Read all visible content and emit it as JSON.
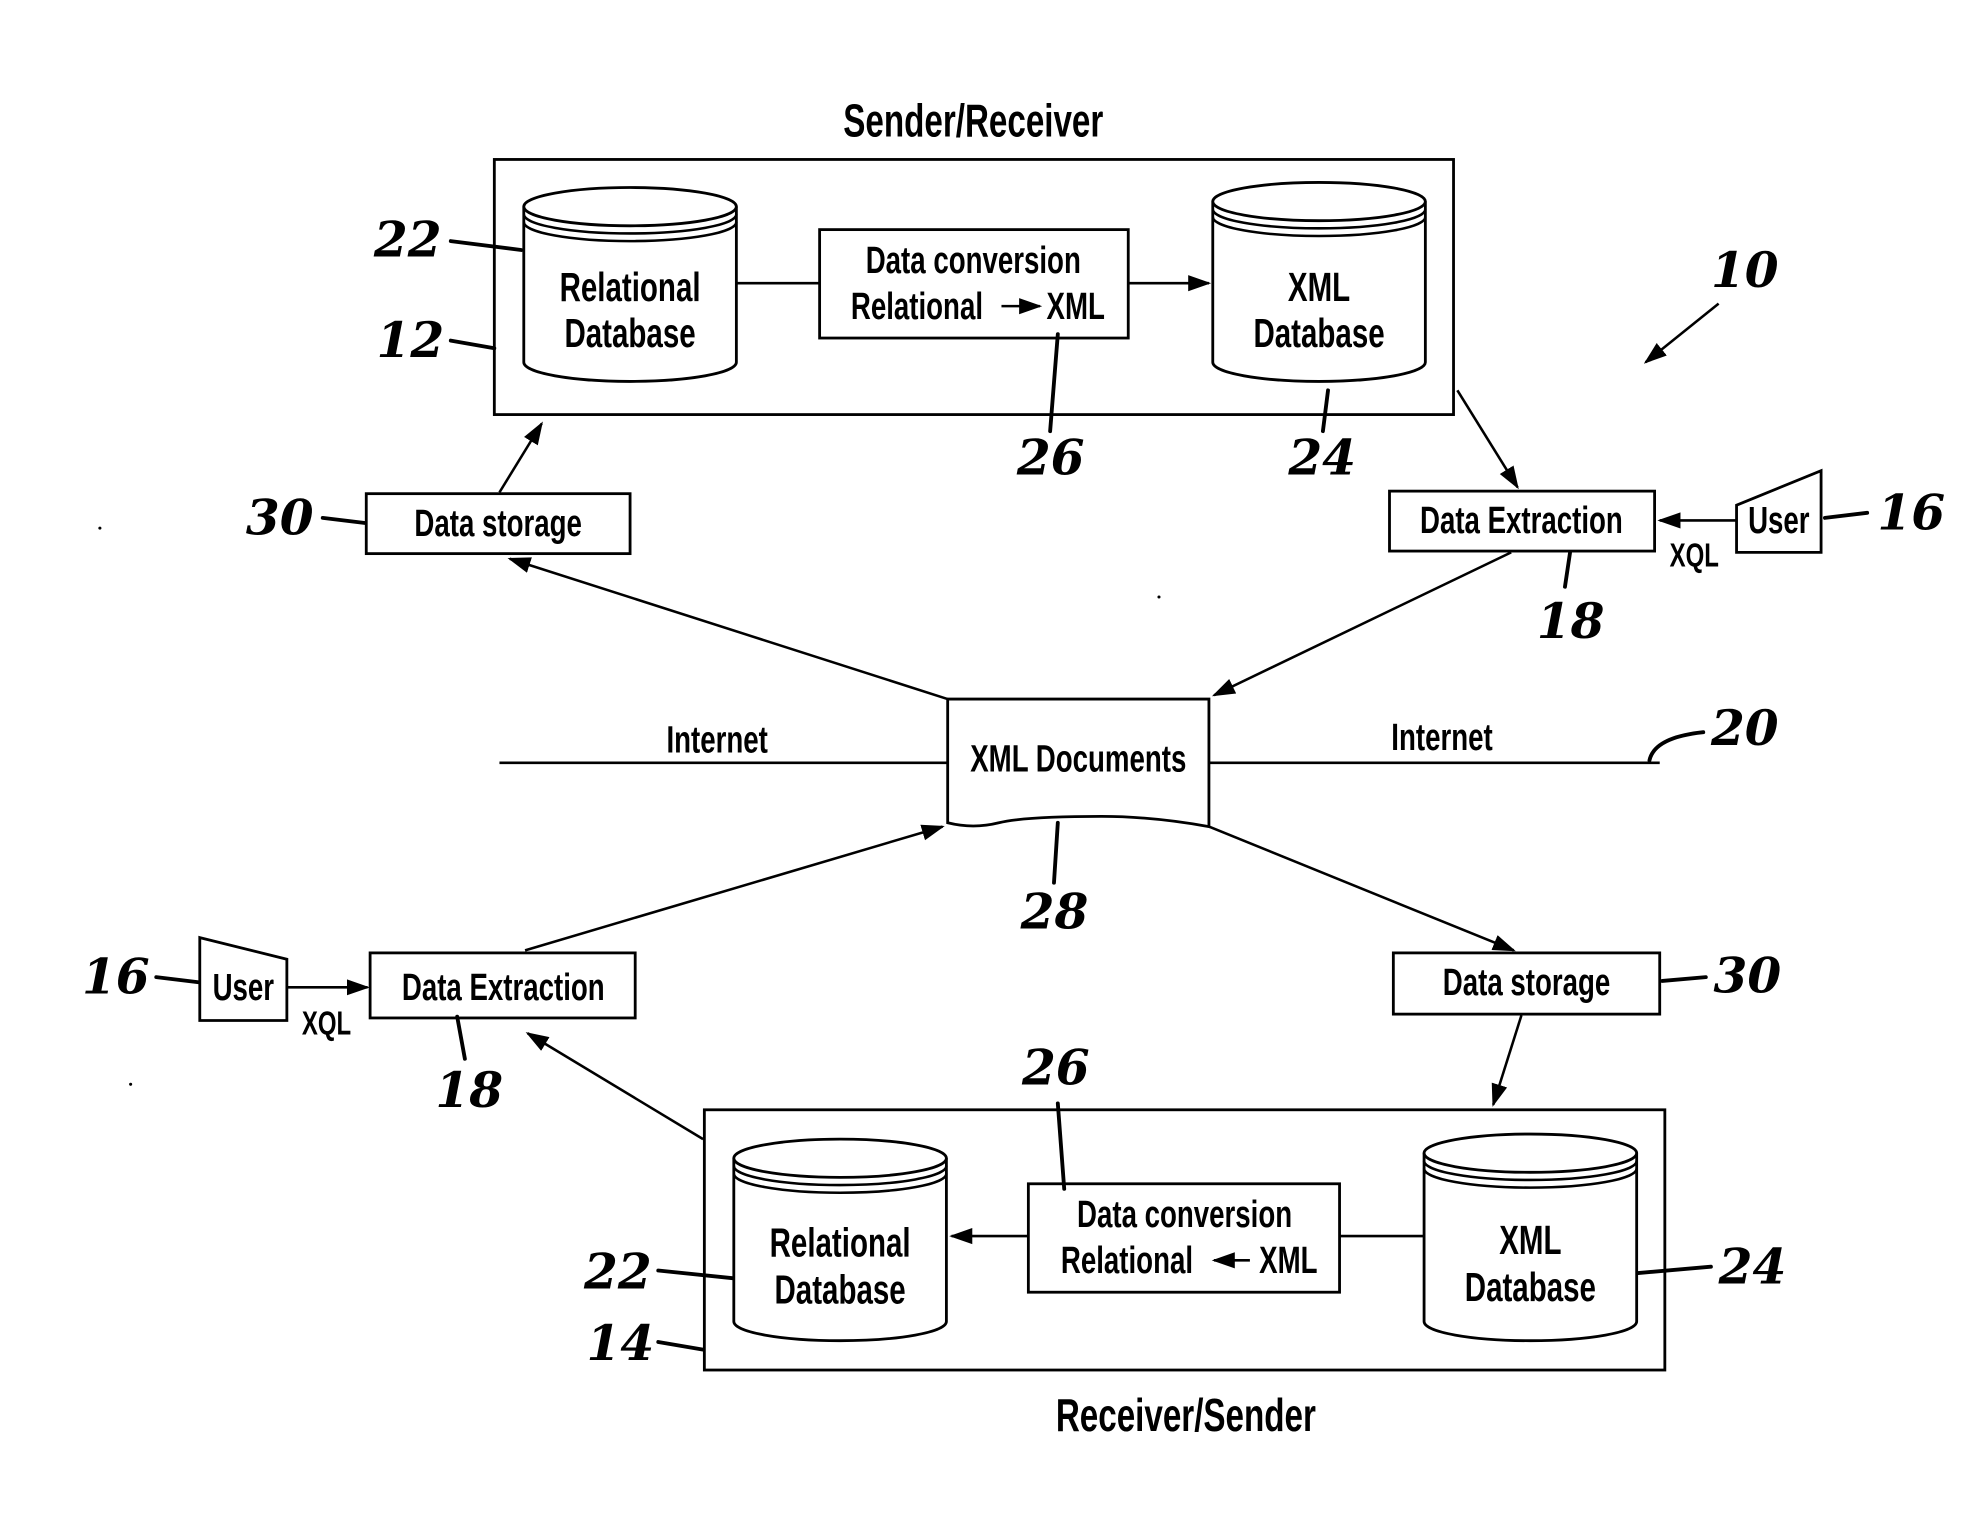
{
  "figure": {
    "system_ref": "10",
    "top_site": {
      "title": "Sender/Receiver",
      "ref": "12",
      "relational_db": {
        "line1": "Relational",
        "line2": "Database",
        "ref": "22"
      },
      "converter": {
        "line1": "Data conversion",
        "line2_left": "Relational",
        "line2_right": "XML",
        "direction": "to-xml",
        "ref": "26"
      },
      "xml_db": {
        "line1": "XML",
        "line2": "Database",
        "ref": "24"
      }
    },
    "bottom_site": {
      "title": "Receiver/Sender",
      "ref": "14",
      "relational_db": {
        "line1": "Relational",
        "line2": "Database",
        "ref": "22"
      },
      "converter": {
        "line1": "Data conversion",
        "line2_left": "Relational",
        "line2_right": "XML",
        "direction": "to-relational",
        "ref": "26"
      },
      "xml_db": {
        "line1": "XML",
        "line2": "Database",
        "ref": "24"
      }
    },
    "top_storage": {
      "label": "Data storage",
      "ref": "30"
    },
    "bottom_storage": {
      "label": "Data storage",
      "ref": "30"
    },
    "top_extraction": {
      "label": "Data Extraction",
      "ref": "18"
    },
    "bottom_extraction": {
      "label": "Data Extraction",
      "ref": "18"
    },
    "top_user": {
      "label": "User",
      "ref": "16",
      "query_language": "XQL"
    },
    "bottom_user": {
      "label": "User",
      "ref": "16",
      "query_language": "XQL"
    },
    "documents": {
      "label": "XML Documents",
      "ref": "28"
    },
    "network": {
      "left_label": "Internet",
      "right_label": "Internet",
      "ref": "20"
    }
  }
}
